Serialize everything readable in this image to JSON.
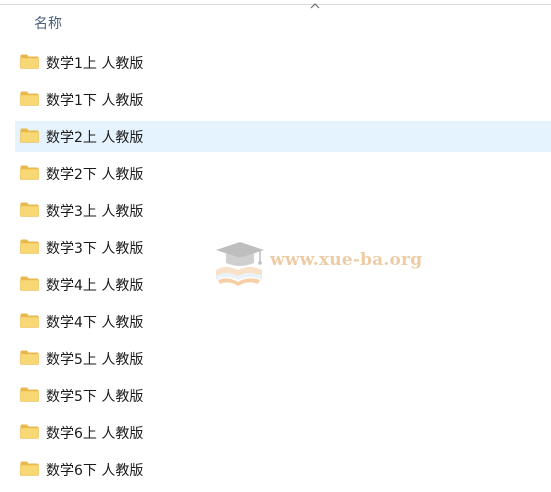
{
  "header": {
    "name_column": "名称"
  },
  "files": [
    {
      "label": "数学1上 人教版",
      "selected": false
    },
    {
      "label": "数学1下 人教版",
      "selected": false
    },
    {
      "label": "数学2上 人教版",
      "selected": true
    },
    {
      "label": "数学2下 人教版",
      "selected": false
    },
    {
      "label": "数学3上 人教版",
      "selected": false
    },
    {
      "label": "数学3下 人教版",
      "selected": false
    },
    {
      "label": "数学4上 人教版",
      "selected": false
    },
    {
      "label": "数学4下 人教版",
      "selected": false
    },
    {
      "label": "数学5上 人教版",
      "selected": false
    },
    {
      "label": "数学5下 人教版",
      "selected": false
    },
    {
      "label": "数学6上 人教版",
      "selected": false
    },
    {
      "label": "数学6下 人教版",
      "selected": false
    }
  ],
  "watermark": {
    "text": "www.xue-ba.org"
  },
  "icons": {
    "folder": "folder-icon",
    "sort": "sort-ascending-icon",
    "watermark_logo": "graduation-cap-logo"
  },
  "colors": {
    "selection": "#e5f3ff",
    "folder_body": "#f8d775",
    "folder_tab": "#e8b84a",
    "header_text": "#4c607a",
    "watermark": "#e0a35c"
  }
}
